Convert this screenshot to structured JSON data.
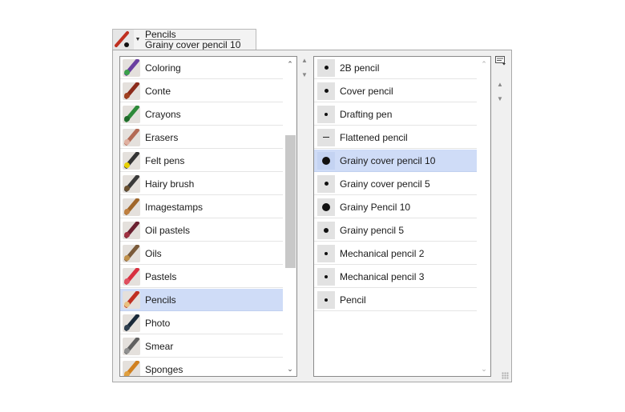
{
  "selector": {
    "category": "Pencils",
    "variant": "Grainy cover pencil 10"
  },
  "categories": [
    {
      "label": "Coloring",
      "icon": "coloring-icon",
      "color": "#6a3fa0",
      "color2": "#3aa04a"
    },
    {
      "label": "Conte",
      "icon": "conte-icon",
      "color": "#8b2a1a",
      "color2": "#a04020"
    },
    {
      "label": "Crayons",
      "icon": "crayons-icon",
      "color": "#2e8a3a",
      "color2": "#1f6a2a"
    },
    {
      "label": "Erasers",
      "icon": "erasers-icon",
      "color": "#b36a55",
      "color2": "#e0b0a0"
    },
    {
      "label": "Felt pens",
      "icon": "felt-pens-icon",
      "color": "#333333",
      "color2": "#e8d000"
    },
    {
      "label": "Hairy brush",
      "icon": "hairy-brush-icon",
      "color": "#3a3a3a",
      "color2": "#6a5030"
    },
    {
      "label": "Imagestamps",
      "icon": "imagestamps-icon",
      "color": "#a0662a",
      "color2": "#c08040"
    },
    {
      "label": "Oil pastels",
      "icon": "oil-pastels-icon",
      "color": "#6a2030",
      "color2": "#a03040"
    },
    {
      "label": "Oils",
      "icon": "oils-icon",
      "color": "#7a5a3a",
      "color2": "#c0904a"
    },
    {
      "label": "Pastels",
      "icon": "pastels-icon",
      "color": "#d83040",
      "color2": "#e05060"
    },
    {
      "label": "Pencils",
      "icon": "pencils-icon",
      "color": "#c03020",
      "color2": "#e8c080",
      "selected": true
    },
    {
      "label": "Photo",
      "icon": "photo-icon",
      "color": "#1a2a3a",
      "color2": "#304050"
    },
    {
      "label": "Smear",
      "icon": "smear-icon",
      "color": "#606060",
      "color2": "#909090"
    },
    {
      "label": "Sponges",
      "icon": "sponges-icon",
      "color": "#d08020",
      "color2": "#e0a040"
    }
  ],
  "variants": [
    {
      "label": "2B pencil",
      "dot": 5
    },
    {
      "label": "Cover pencil",
      "dot": 5
    },
    {
      "label": "Drafting pen",
      "dot": 4
    },
    {
      "label": "Flattened pencil",
      "dot": 0
    },
    {
      "label": "Grainy cover pencil 10",
      "dot": 10,
      "selected": true
    },
    {
      "label": "Grainy cover pencil 5",
      "dot": 5
    },
    {
      "label": "Grainy Pencil 10",
      "dot": 10
    },
    {
      "label": "Grainy pencil 5",
      "dot": 6
    },
    {
      "label": "Mechanical pencil 2",
      "dot": 4
    },
    {
      "label": "Mechanical pencil 3",
      "dot": 4
    },
    {
      "label": "Pencil",
      "dot": 4
    }
  ]
}
